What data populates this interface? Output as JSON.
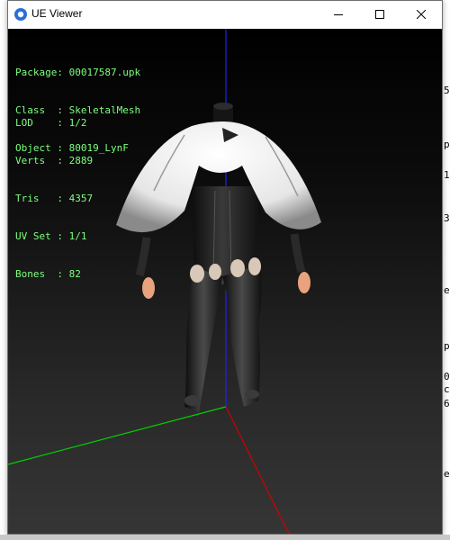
{
  "window": {
    "title": "UE Viewer"
  },
  "info_block1": [
    {
      "key": "Package",
      "value": "00017587.upk"
    },
    {
      "key": "Class  ",
      "value": "SkeletalMesh"
    },
    {
      "key": "Object ",
      "value": "80019_LynF"
    }
  ],
  "info_block2": [
    {
      "key": "LOD    ",
      "value": "1/2"
    },
    {
      "key": "Verts  ",
      "value": "2889"
    },
    {
      "key": "Tris   ",
      "value": "4357"
    },
    {
      "key": "UV Set ",
      "value": "1/1"
    },
    {
      "key": "Bones  ",
      "value": "82"
    }
  ],
  "right_console": [
    "5",
    "p",
    "1",
    "3",
    "e",
    "p",
    "0",
    "c",
    "6",
    "e"
  ],
  "colors": {
    "text_green": "#7dff7d",
    "axis_x": "#d00000",
    "axis_y": "#00d000",
    "axis_z": "#2020ff"
  }
}
